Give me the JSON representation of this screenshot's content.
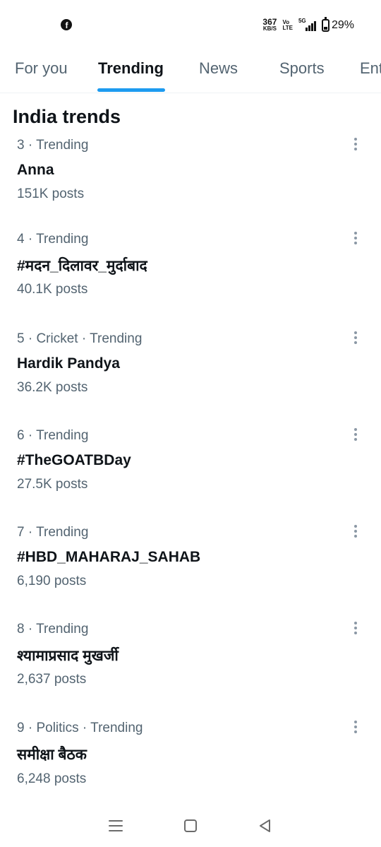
{
  "status_bar": {
    "left_icon": "facebook-icon",
    "net_speed_value": "367",
    "net_speed_unit": "KB/S",
    "volte_top": "Vo",
    "volte_bottom": "LTE",
    "network_tag": "5G",
    "battery_percent": "29%"
  },
  "tabs": [
    {
      "label": "For you",
      "active": false
    },
    {
      "label": "Trending",
      "active": true
    },
    {
      "label": "News",
      "active": false
    },
    {
      "label": "Sports",
      "active": false
    },
    {
      "label": "Ent",
      "active": false
    }
  ],
  "section_title": "India trends",
  "trends": [
    {
      "meta": "3 · Trending",
      "name": "Anna",
      "posts": "151K posts"
    },
    {
      "meta": "4 · Trending",
      "name": "#मदन_दिलावर_मुर्दाबाद",
      "posts": "40.1K posts"
    },
    {
      "meta": "5 · Cricket · Trending",
      "name": "Hardik Pandya",
      "posts": "36.2K posts"
    },
    {
      "meta": "6 · Trending",
      "name": "#TheGOATBDay",
      "posts": "27.5K posts"
    },
    {
      "meta": "7 · Trending",
      "name": "#HBD_MAHARAJ_SAHAB",
      "posts": "6,190 posts"
    },
    {
      "meta": "8 · Trending",
      "name": "श्यामाप्रसाद मुखर्जी",
      "posts": "2,637 posts"
    },
    {
      "meta": "9 · Politics · Trending",
      "name": "समीक्षा बैठक",
      "posts": "6,248 posts"
    }
  ],
  "colors": {
    "accent": "#1d9bf0",
    "text_primary": "#0f1419",
    "text_secondary": "#536471"
  }
}
